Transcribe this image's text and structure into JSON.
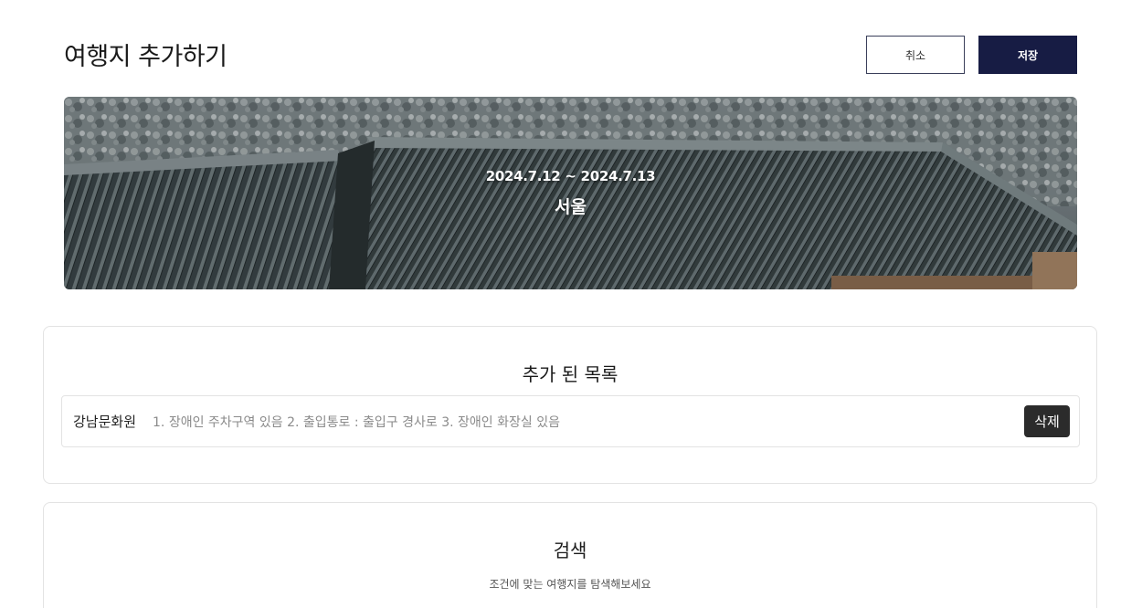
{
  "header": {
    "title": "여행지 추가하기",
    "cancel_label": "취소",
    "save_label": "저장"
  },
  "banner": {
    "dates": "2024.7.12 ~ 2024.7.13",
    "city": "서울"
  },
  "added_list": {
    "title": "추가 된 목록",
    "items": [
      {
        "name": "강남문화원",
        "description": "1. 장애인 주차구역 있음  2. 출입통로 : 출입구 경사로  3. 장애인 화장실 있음",
        "delete_label": "삭제"
      }
    ]
  },
  "search": {
    "title": "검색",
    "subtitle": "조건에 맞는 여행지를 탐색해보세요"
  },
  "colors": {
    "primary": "#171c44",
    "delete_button": "#2b2b2b",
    "border": "#e3e3e3"
  }
}
